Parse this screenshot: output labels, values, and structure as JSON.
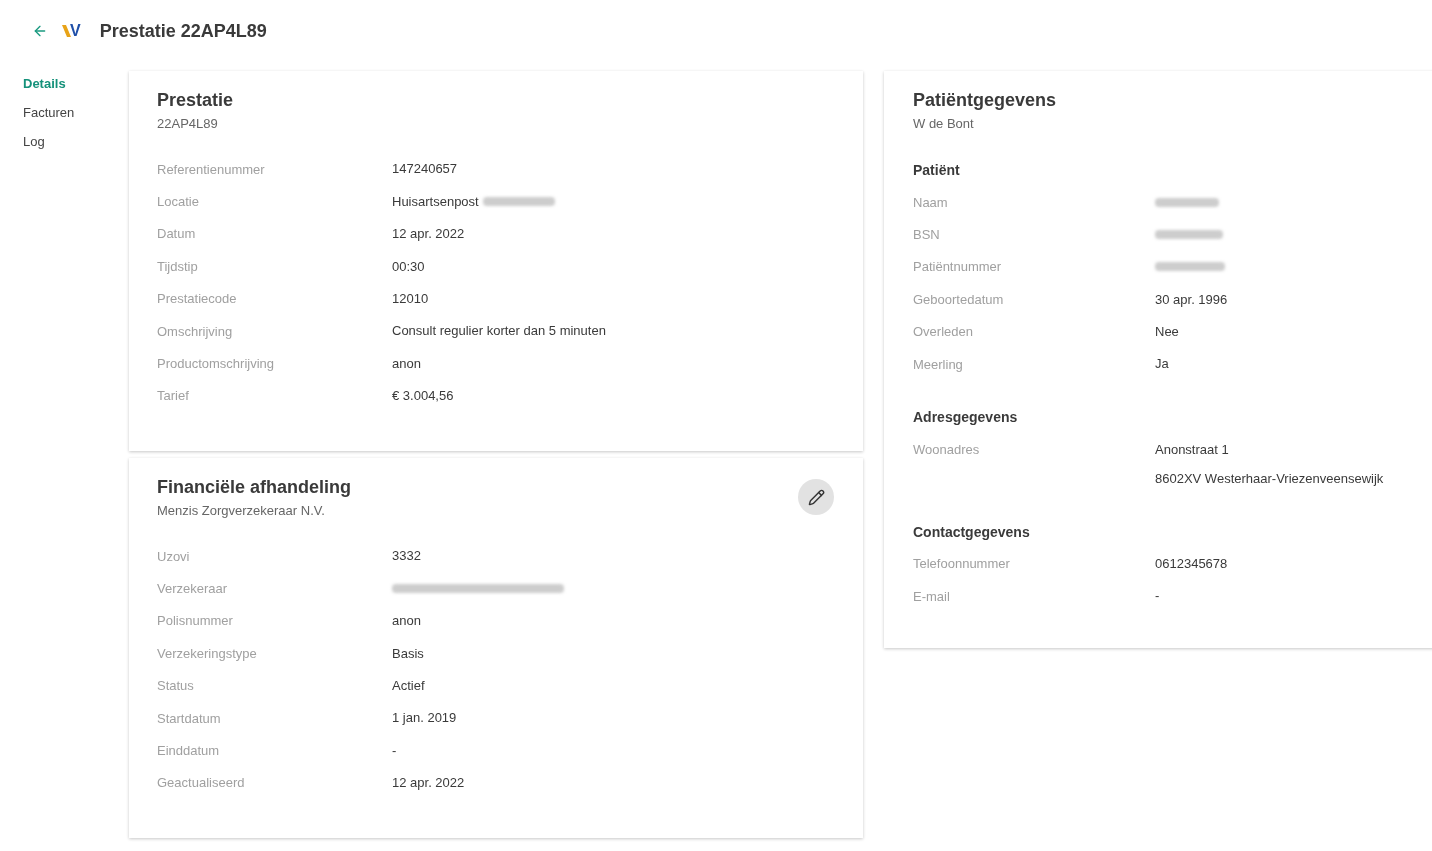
{
  "header": {
    "logo": {
      "letter": "V"
    },
    "title": "Prestatie 22AP4L89"
  },
  "nav": [
    {
      "label": "Details",
      "selected": true
    },
    {
      "label": "Facturen",
      "selected": false
    },
    {
      "label": "Log",
      "selected": false
    }
  ],
  "cards": [
    {
      "title": "Prestatie",
      "subtitle": "22AP4L89",
      "editable": false,
      "fields": [
        {
          "label": "Referentienummer",
          "lines": [
            "147240657"
          ],
          "redacted": false
        },
        {
          "label": "Locatie",
          "lines": [
            "Huisartsenpost"
          ],
          "redacted": true
        },
        {
          "label": "Datum",
          "lines": [
            "12 apr. 2022"
          ],
          "redacted": false
        },
        {
          "label": "Tijdstip",
          "lines": [
            "00:30"
          ],
          "redacted": false
        },
        {
          "label": "Prestatiecode",
          "lines": [
            "12010"
          ],
          "redacted": false
        },
        {
          "label": "Omschrijving",
          "lines": [
            "Consult regulier korter dan 5 minuten"
          ],
          "redacted": false
        },
        {
          "label": "Productomschrijving",
          "lines": [
            "anon"
          ],
          "redacted": false
        },
        {
          "label": "Tarief",
          "lines": [
            "€ 3.004,56"
          ],
          "redacted": false
        }
      ]
    },
    {
      "title": "Financiële afhandeling",
      "subtitle": "Menzis Zorgverzekeraar N.V.",
      "editable": true,
      "fields": [
        {
          "label": "Uzovi",
          "lines": [
            "3332"
          ],
          "redacted": false
        },
        {
          "label": "Verzekeraar",
          "redacted": true
        },
        {
          "label": "Polisnummer",
          "lines": [
            "anon"
          ],
          "redacted": false
        },
        {
          "label": "Verzekeringstype",
          "lines": [
            "Basis"
          ],
          "redacted": false
        },
        {
          "label": "Status",
          "lines": [
            "Actief"
          ],
          "redacted": false
        },
        {
          "label": "Startdatum",
          "lines": [
            "1 jan. 2019"
          ],
          "redacted": false
        },
        {
          "label": "Einddatum",
          "lines": [
            "-"
          ],
          "redacted": false
        },
        {
          "label": "Geactualiseerd",
          "lines": [
            "12 apr. 2022"
          ],
          "redacted": false
        }
      ]
    }
  ],
  "patient_card": {
    "title": "Patiëntgegevens",
    "subtitle": "W de Bont",
    "sections": [
      {
        "heading": "Patiënt",
        "fields": [
          {
            "label": "Naam",
            "redacted": true
          },
          {
            "label": "BSN",
            "redacted": true
          },
          {
            "label": "Patiëntnummer",
            "redacted": true
          },
          {
            "label": "Geboortedatum",
            "lines": [
              "30 apr. 1996"
            ],
            "redacted": false
          },
          {
            "label": "Overleden",
            "lines": [
              "Nee"
            ],
            "redacted": false
          },
          {
            "label": "Meerling",
            "lines": [
              "Ja"
            ],
            "redacted": false
          }
        ]
      },
      {
        "heading": "Adresgegevens",
        "fields": [
          {
            "label": "Woonadres",
            "lines": [
              "Anonstraat 1",
              "8602XV Westerhaar-Vriezenveensewijk"
            ],
            "redacted": false
          }
        ]
      },
      {
        "heading": "Contactgegevens",
        "fields": [
          {
            "label": "Telefoonnummer",
            "lines": [
              "0612345678"
            ],
            "redacted": false
          },
          {
            "label": "E-mail",
            "lines": [
              "-"
            ],
            "redacted": false
          }
        ]
      }
    ]
  }
}
